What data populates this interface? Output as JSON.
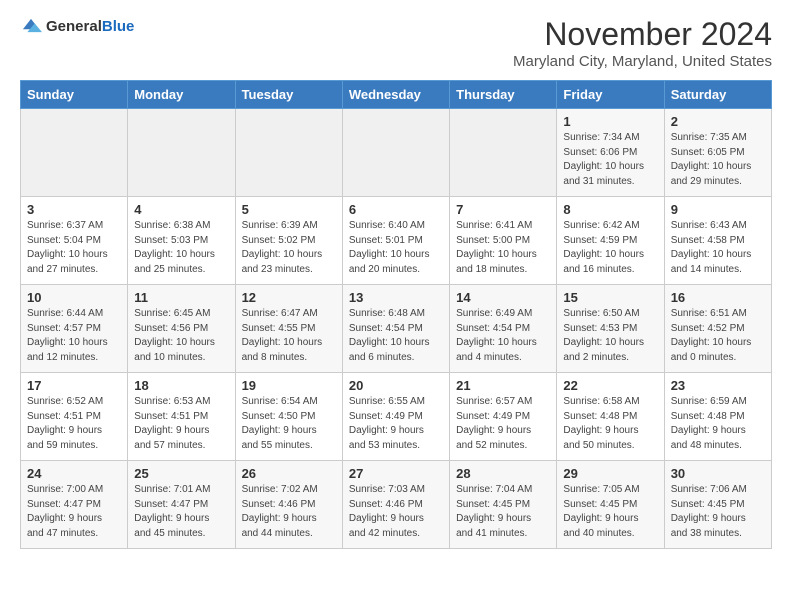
{
  "logo": {
    "general": "General",
    "blue": "Blue"
  },
  "title": "November 2024",
  "subtitle": "Maryland City, Maryland, United States",
  "days_header": [
    "Sunday",
    "Monday",
    "Tuesday",
    "Wednesday",
    "Thursday",
    "Friday",
    "Saturday"
  ],
  "weeks": [
    [
      {
        "day": "",
        "info": ""
      },
      {
        "day": "",
        "info": ""
      },
      {
        "day": "",
        "info": ""
      },
      {
        "day": "",
        "info": ""
      },
      {
        "day": "",
        "info": ""
      },
      {
        "day": "1",
        "info": "Sunrise: 7:34 AM\nSunset: 6:06 PM\nDaylight: 10 hours\nand 31 minutes."
      },
      {
        "day": "2",
        "info": "Sunrise: 7:35 AM\nSunset: 6:05 PM\nDaylight: 10 hours\nand 29 minutes."
      }
    ],
    [
      {
        "day": "3",
        "info": "Sunrise: 6:37 AM\nSunset: 5:04 PM\nDaylight: 10 hours\nand 27 minutes."
      },
      {
        "day": "4",
        "info": "Sunrise: 6:38 AM\nSunset: 5:03 PM\nDaylight: 10 hours\nand 25 minutes."
      },
      {
        "day": "5",
        "info": "Sunrise: 6:39 AM\nSunset: 5:02 PM\nDaylight: 10 hours\nand 23 minutes."
      },
      {
        "day": "6",
        "info": "Sunrise: 6:40 AM\nSunset: 5:01 PM\nDaylight: 10 hours\nand 20 minutes."
      },
      {
        "day": "7",
        "info": "Sunrise: 6:41 AM\nSunset: 5:00 PM\nDaylight: 10 hours\nand 18 minutes."
      },
      {
        "day": "8",
        "info": "Sunrise: 6:42 AM\nSunset: 4:59 PM\nDaylight: 10 hours\nand 16 minutes."
      },
      {
        "day": "9",
        "info": "Sunrise: 6:43 AM\nSunset: 4:58 PM\nDaylight: 10 hours\nand 14 minutes."
      }
    ],
    [
      {
        "day": "10",
        "info": "Sunrise: 6:44 AM\nSunset: 4:57 PM\nDaylight: 10 hours\nand 12 minutes."
      },
      {
        "day": "11",
        "info": "Sunrise: 6:45 AM\nSunset: 4:56 PM\nDaylight: 10 hours\nand 10 minutes."
      },
      {
        "day": "12",
        "info": "Sunrise: 6:47 AM\nSunset: 4:55 PM\nDaylight: 10 hours\nand 8 minutes."
      },
      {
        "day": "13",
        "info": "Sunrise: 6:48 AM\nSunset: 4:54 PM\nDaylight: 10 hours\nand 6 minutes."
      },
      {
        "day": "14",
        "info": "Sunrise: 6:49 AM\nSunset: 4:54 PM\nDaylight: 10 hours\nand 4 minutes."
      },
      {
        "day": "15",
        "info": "Sunrise: 6:50 AM\nSunset: 4:53 PM\nDaylight: 10 hours\nand 2 minutes."
      },
      {
        "day": "16",
        "info": "Sunrise: 6:51 AM\nSunset: 4:52 PM\nDaylight: 10 hours\nand 0 minutes."
      }
    ],
    [
      {
        "day": "17",
        "info": "Sunrise: 6:52 AM\nSunset: 4:51 PM\nDaylight: 9 hours\nand 59 minutes."
      },
      {
        "day": "18",
        "info": "Sunrise: 6:53 AM\nSunset: 4:51 PM\nDaylight: 9 hours\nand 57 minutes."
      },
      {
        "day": "19",
        "info": "Sunrise: 6:54 AM\nSunset: 4:50 PM\nDaylight: 9 hours\nand 55 minutes."
      },
      {
        "day": "20",
        "info": "Sunrise: 6:55 AM\nSunset: 4:49 PM\nDaylight: 9 hours\nand 53 minutes."
      },
      {
        "day": "21",
        "info": "Sunrise: 6:57 AM\nSunset: 4:49 PM\nDaylight: 9 hours\nand 52 minutes."
      },
      {
        "day": "22",
        "info": "Sunrise: 6:58 AM\nSunset: 4:48 PM\nDaylight: 9 hours\nand 50 minutes."
      },
      {
        "day": "23",
        "info": "Sunrise: 6:59 AM\nSunset: 4:48 PM\nDaylight: 9 hours\nand 48 minutes."
      }
    ],
    [
      {
        "day": "24",
        "info": "Sunrise: 7:00 AM\nSunset: 4:47 PM\nDaylight: 9 hours\nand 47 minutes."
      },
      {
        "day": "25",
        "info": "Sunrise: 7:01 AM\nSunset: 4:47 PM\nDaylight: 9 hours\nand 45 minutes."
      },
      {
        "day": "26",
        "info": "Sunrise: 7:02 AM\nSunset: 4:46 PM\nDaylight: 9 hours\nand 44 minutes."
      },
      {
        "day": "27",
        "info": "Sunrise: 7:03 AM\nSunset: 4:46 PM\nDaylight: 9 hours\nand 42 minutes."
      },
      {
        "day": "28",
        "info": "Sunrise: 7:04 AM\nSunset: 4:45 PM\nDaylight: 9 hours\nand 41 minutes."
      },
      {
        "day": "29",
        "info": "Sunrise: 7:05 AM\nSunset: 4:45 PM\nDaylight: 9 hours\nand 40 minutes."
      },
      {
        "day": "30",
        "info": "Sunrise: 7:06 AM\nSunset: 4:45 PM\nDaylight: 9 hours\nand 38 minutes."
      }
    ]
  ]
}
